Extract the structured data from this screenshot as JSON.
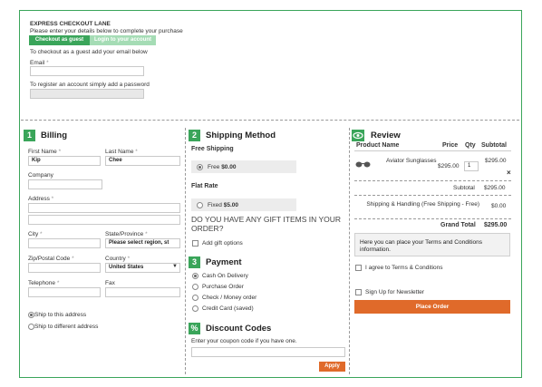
{
  "express": {
    "title": "EXPRESS CHECKOUT LANE",
    "subtitle": "Please enter your details below to complete your purchase",
    "tab_guest": "Checkout as guest",
    "tab_login": "Login to your account",
    "guest_hint": "To checkout as a guest add your email below",
    "email_label": "Email",
    "req": "*",
    "password_hint": "To register an account simply add a password"
  },
  "billing": {
    "num": "1",
    "title": "Billing",
    "first_name_label": "First Name",
    "first_name_value": "Kip",
    "last_name_label": "Last Name",
    "last_name_value": "Chee",
    "company_label": "Company",
    "address_label": "Address",
    "city_label": "City",
    "state_label": "State/Province",
    "state_value": "Please select region, st",
    "zip_label": "Zip/Postal Code",
    "country_label": "Country",
    "country_value": "United States",
    "telephone_label": "Telephone",
    "fax_label": "Fax",
    "ship_same": "Ship to this address",
    "ship_diff": "Ship to different address"
  },
  "shipping": {
    "num": "2",
    "title": "Shipping Method",
    "free_heading": "Free Shipping",
    "free_label": "Free",
    "free_price": "$0.00",
    "flat_heading": "Flat Rate",
    "flat_label": "Fixed",
    "flat_price": "$5.00",
    "gift_question": "DO YOU HAVE ANY GIFT ITEMS IN YOUR ORDER?",
    "gift_option": "Add gift options"
  },
  "payment": {
    "num": "3",
    "title": "Payment",
    "options": [
      "Cash On Delivery",
      "Purchase Order",
      "Check / Money order",
      "Credit Card (saved)"
    ]
  },
  "discount": {
    "num": "%",
    "title": "Discount Codes",
    "hint": "Enter your coupon code if you have one.",
    "apply": "Apply"
  },
  "review": {
    "title": "Review",
    "col_product": "Product Name",
    "col_price": "Price",
    "col_qty": "Qty",
    "col_subtotal": "Subtotal",
    "item_name": "Aviator Sunglasses",
    "item_price": "$295.00",
    "item_qty": "1",
    "item_subtotal": "$295.00",
    "remove": "×",
    "subtotal_label": "Subtotal",
    "subtotal_value": "$295.00",
    "shipping_label": "Shipping & Handling (Free Shipping - Free)",
    "shipping_value": "$0.00",
    "grand_label": "Grand Total",
    "grand_value": "$295.00",
    "terms_text": "Here you can place your Terms and Conditions information.",
    "agree": "I agree to Terms & Conditions",
    "newsletter": "Sign Up for Newsletter",
    "place_order": "Place Order"
  },
  "colors": {
    "accent_green": "#3aa55a",
    "light_green": "#a5dcb5",
    "order_orange": "#e06a2a"
  }
}
